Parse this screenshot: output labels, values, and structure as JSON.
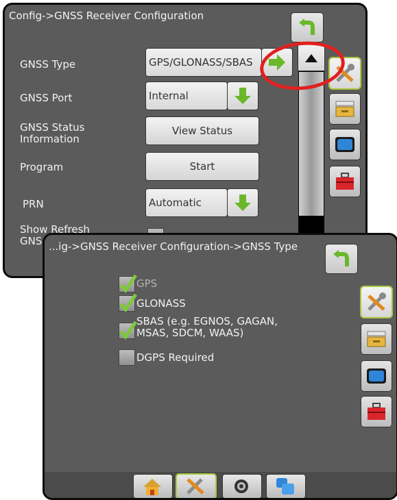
{
  "back_panel": {
    "title": "Config->GNSS Receiver Configuration",
    "rows": [
      {
        "label": "GNSS Type",
        "value": "GPS/GLONASS/SBAS"
      },
      {
        "label": "GNSS Port",
        "value": "Internal"
      },
      {
        "label": "GNSS Status Information",
        "value": "View Status"
      },
      {
        "label": "Program",
        "value": "Start"
      },
      {
        "label": "PRN",
        "value": "Automatic"
      },
      {
        "label": "Show Refresh GNS",
        "value": ""
      }
    ]
  },
  "front_panel": {
    "title": "...ig->GNSS Receiver Configuration->GNSS Type",
    "options": [
      {
        "label": "GPS",
        "checked": true,
        "disabled": true
      },
      {
        "label": "GLONASS",
        "checked": true
      },
      {
        "label": "SBAS (e.g. EGNOS, GAGAN, MSAS, SDCM, WAAS)",
        "checked": true
      },
      {
        "label": "DGPS Required",
        "checked": false
      }
    ]
  },
  "side_icons": [
    "tools-icon",
    "console-icon",
    "display-icon",
    "toolbox-icon"
  ],
  "bottom_tabs": [
    "home-icon",
    "tools-icon",
    "gnss-icon",
    "data-icon"
  ],
  "colors": {
    "accent": "#a7c83a",
    "check": "#7ec83a",
    "annotation": "#e12020",
    "panel": "#5b5b5b"
  }
}
